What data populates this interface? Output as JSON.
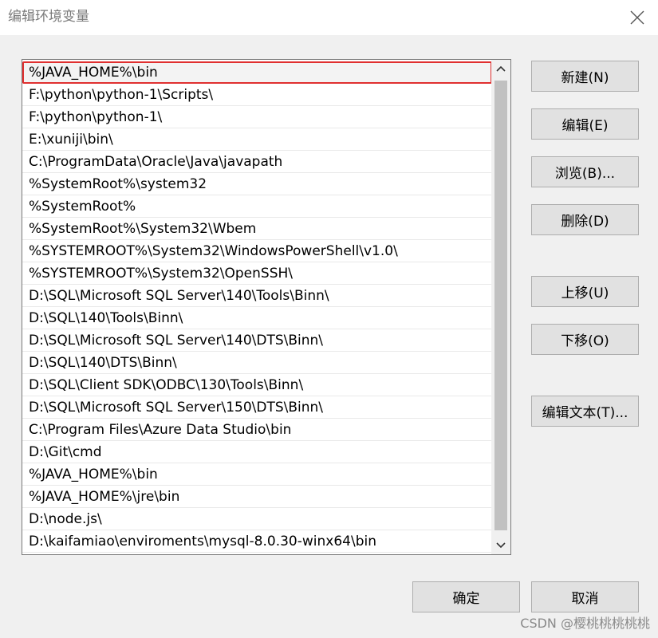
{
  "window": {
    "title": "编辑环境变量",
    "close_icon": "close-icon"
  },
  "list": {
    "selected_index": 0,
    "items": [
      "%JAVA_HOME%\\bin",
      "F:\\python\\python-1\\Scripts\\",
      "F:\\python\\python-1\\",
      "E:\\xuniji\\bin\\",
      "C:\\ProgramData\\Oracle\\Java\\javapath",
      "%SystemRoot%\\system32",
      "%SystemRoot%",
      "%SystemRoot%\\System32\\Wbem",
      "%SYSTEMROOT%\\System32\\WindowsPowerShell\\v1.0\\",
      "%SYSTEMROOT%\\System32\\OpenSSH\\",
      "D:\\SQL\\Microsoft SQL Server\\140\\Tools\\Binn\\",
      "D:\\SQL\\140\\Tools\\Binn\\",
      "D:\\SQL\\Microsoft SQL Server\\140\\DTS\\Binn\\",
      "D:\\SQL\\140\\DTS\\Binn\\",
      "D:\\SQL\\Client SDK\\ODBC\\130\\Tools\\Binn\\",
      "D:\\SQL\\Microsoft SQL Server\\150\\DTS\\Binn\\",
      "C:\\Program Files\\Azure Data Studio\\bin",
      "D:\\Git\\cmd",
      "%JAVA_HOME%\\bin",
      "%JAVA_HOME%\\jre\\bin",
      "D:\\node.js\\",
      "D:\\kaifamiao\\enviroments\\mysql-8.0.30-winx64\\bin"
    ]
  },
  "buttons": {
    "new": "新建(N)",
    "edit": "编辑(E)",
    "browse": "浏览(B)...",
    "delete": "删除(D)",
    "move_up": "上移(U)",
    "move_down": "下移(O)",
    "edit_text": "编辑文本(T)...",
    "ok": "确定",
    "cancel": "取消"
  },
  "watermark": "CSDN @樱桃桃桃桃桃",
  "colors": {
    "selection_border": "#e03030",
    "button_bg": "#e1e1e1"
  }
}
